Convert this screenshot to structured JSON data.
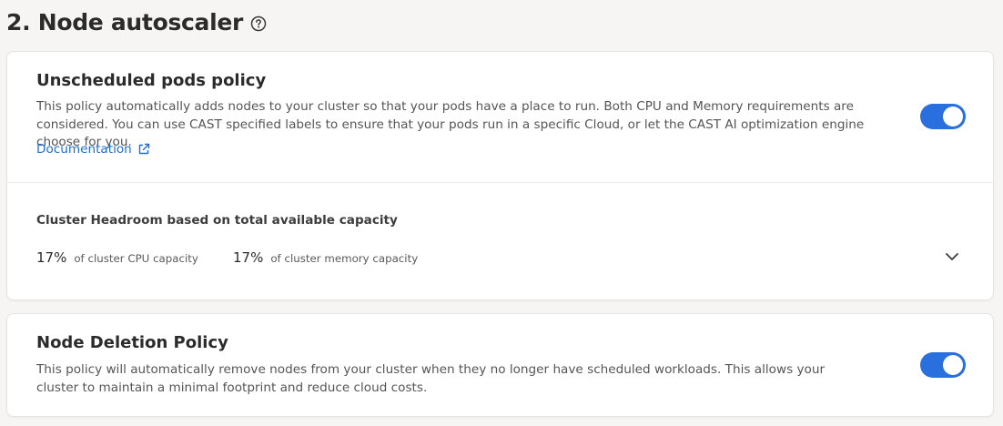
{
  "header": {
    "title": "2. Node autoscaler",
    "help_icon": "question-circle-icon"
  },
  "unscheduled_pods": {
    "title": "Unscheduled pods policy",
    "description": "This policy automatically adds nodes to your cluster so that your pods have a place to run. Both CPU and Memory requirements are considered. You can use CAST specified labels to ensure that your pods run in a specific Cloud, or let the CAST AI optimization engine choose for you.",
    "documentation_label": "Documentation",
    "documentation_icon": "external-link-icon",
    "enabled": true,
    "headroom": {
      "title": "Cluster Headroom based on total available capacity",
      "cpu_value": "17%",
      "cpu_label": "of cluster CPU capacity",
      "memory_value": "17%",
      "memory_label": "of cluster memory capacity",
      "expand_icon": "chevron-down-icon"
    }
  },
  "node_deletion": {
    "title": "Node Deletion Policy",
    "description": "This policy will automatically remove nodes from your cluster when they no longer have scheduled workloads. This allows your cluster to maintain a minimal footprint and reduce cloud costs.",
    "enabled": true
  },
  "colors": {
    "accent": "#2a6fde",
    "link": "#1e6ed6",
    "background": "#f6f5f3",
    "card": "#ffffff"
  }
}
